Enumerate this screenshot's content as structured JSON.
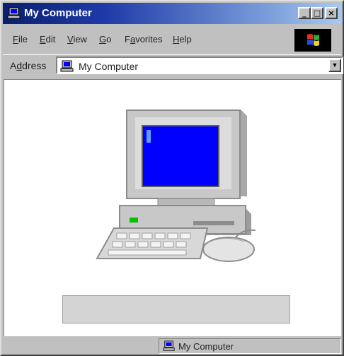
{
  "window": {
    "title": "My Computer",
    "buttons": {
      "minimize": "_",
      "maximize": "□",
      "close": "×"
    }
  },
  "menu": {
    "items": [
      {
        "label": "File",
        "mnemonic": "F",
        "rest": "ile"
      },
      {
        "label": "Edit",
        "mnemonic": "E",
        "rest": "dit"
      },
      {
        "label": "View",
        "mnemonic": "V",
        "rest": "iew"
      },
      {
        "label": "Go",
        "mnemonic": "G",
        "rest": "o"
      },
      {
        "label": "Favorites",
        "mnemonic": "a",
        "before": "F",
        "rest": "vorites"
      },
      {
        "label": "Help",
        "mnemonic": "H",
        "rest": "elp"
      }
    ]
  },
  "address": {
    "label_before": "A",
    "label_mnemonic": "d",
    "label_after": "dress",
    "value": "My Computer",
    "dropdown_icon": "▼"
  },
  "status": {
    "text": "My Computer"
  },
  "icons": {
    "title": "computer-icon",
    "address": "computer-icon",
    "status": "computer-icon",
    "main": "my-computer-large-icon",
    "logo": "windows-logo-icon"
  },
  "colors": {
    "titlebar_start": "#0a1f6e",
    "titlebar_end": "#a6caf0",
    "screen": "#0000ff",
    "power_led": "#00c000"
  }
}
